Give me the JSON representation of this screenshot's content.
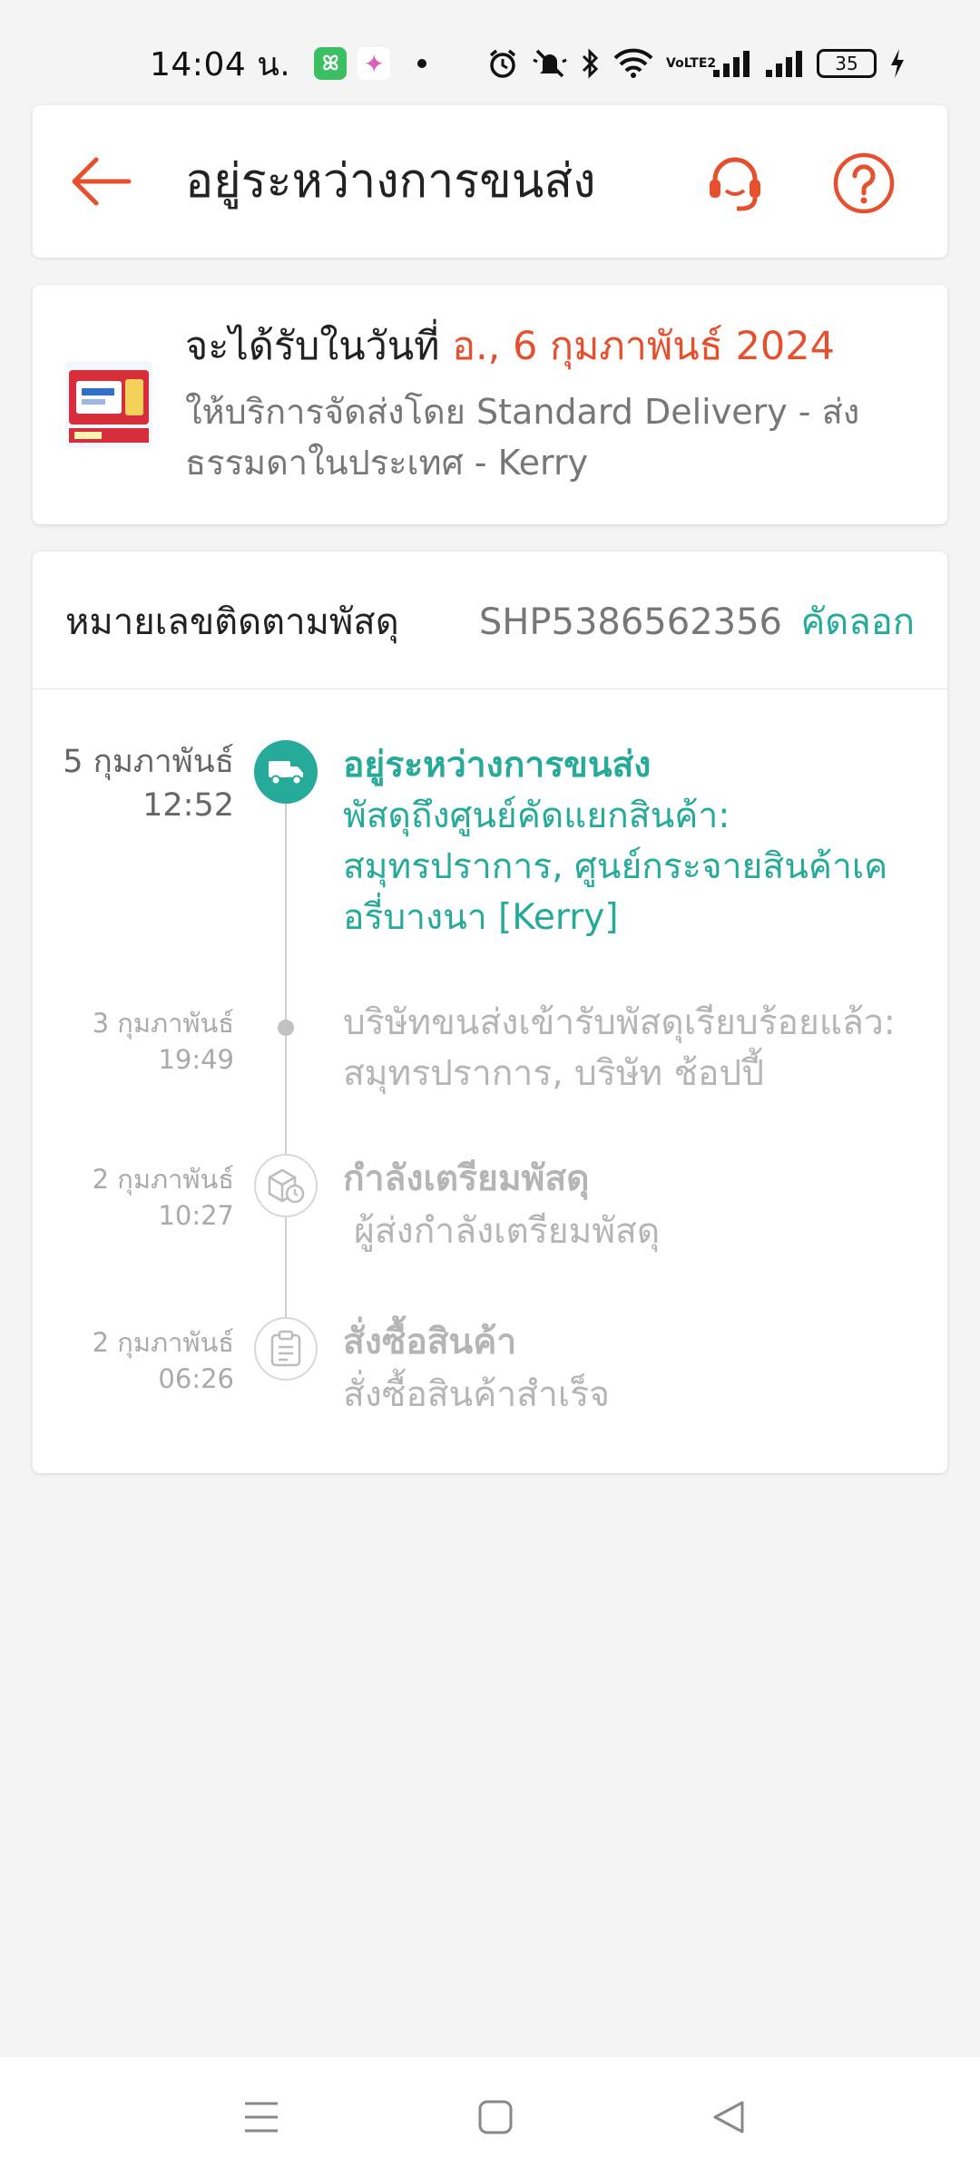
{
  "status_bar": {
    "time": "14:04 น.",
    "battery": "35",
    "network_label": "VoLTE2"
  },
  "header": {
    "title": "อยู่ระหว่างการขนส่ง"
  },
  "delivery": {
    "eta_prefix": "จะได้รับในวันที่",
    "eta_date": "อ., 6 กุมภาพันธ์ 2024",
    "service": "ให้บริการจัดส่งโดย Standard Delivery - ส่งธรรมดาในประเทศ - Kerry"
  },
  "tracking": {
    "label": "หมายเลขติดตามพัสดุ",
    "number": "SHP5386562356",
    "copy_label": "คัดลอก",
    "events": [
      {
        "date": "5 กุมภาพันธ์",
        "time": "12:52",
        "title": "อยู่ระหว่างการขนส่ง",
        "description": "พัสดุถึงศูนย์คัดแยกสินค้า: สมุทรปราการ, ศูนย์กระจายสินค้าเคอรี่บางนา  [Kerry]"
      },
      {
        "date": "3 กุมภาพันธ์",
        "time": "19:49",
        "title": "",
        "description": "บริษัทขนส่งเข้ารับพัสดุเรียบร้อยแล้ว: สมุทรปราการ, บริษัท ช้อปปี้"
      },
      {
        "date": "2 กุมภาพันธ์",
        "time": "10:27",
        "title": "กำลังเตรียมพัสดุ",
        "description": "ผู้ส่งกำลังเตรียมพัสดุ"
      },
      {
        "date": "2 กุมภาพันธ์",
        "time": "06:26",
        "title": "สั่งซื้อสินค้า",
        "description": "สั่งซื้อสินค้าสำเร็จ"
      }
    ]
  },
  "colors": {
    "accent_orange": "#e5512f",
    "accent_teal": "#26aa99",
    "muted_text": "#b5b5b5"
  },
  "icons": {
    "back": "arrow-left-icon",
    "support": "headset-icon",
    "help": "question-circle-icon",
    "transit": "truck-icon",
    "preparing": "package-clock-icon",
    "ordered": "clipboard-icon"
  }
}
